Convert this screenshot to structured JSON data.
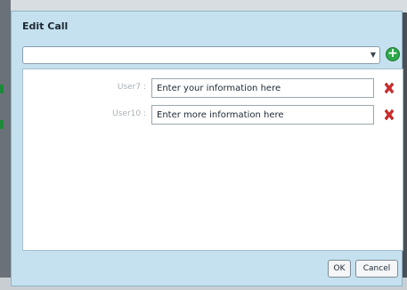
{
  "dialog": {
    "title": "Edit Call"
  },
  "call_select": {
    "selected_value": ""
  },
  "users": [
    {
      "label": "User7 :",
      "value": "Enter your information here"
    },
    {
      "label": "User10 :",
      "value": "Enter more information here"
    }
  ],
  "buttons": {
    "ok_label": "OK",
    "cancel_label": "Cancel"
  },
  "colors": {
    "dialog_bg": "#c5e1ef",
    "add_green": "#2ea84a",
    "remove_red": "#d42a2a"
  }
}
